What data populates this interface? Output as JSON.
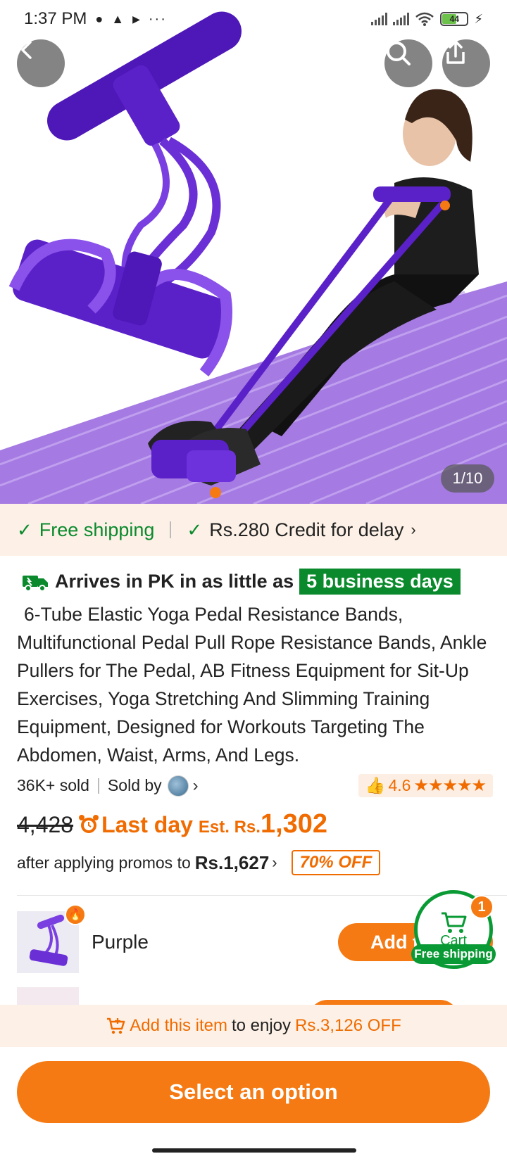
{
  "status_bar": {
    "time": "1:37 PM",
    "battery": "44",
    "left_icons": [
      "chat-icon",
      "snapchat-icon",
      "play-icon",
      "more-dots-icon"
    ],
    "right_icons": [
      "signal-icon",
      "signal-icon",
      "wifi-icon",
      "battery-icon",
      "charging-icon"
    ]
  },
  "hero": {
    "image_counter": "1/10",
    "icons": [
      "back-icon",
      "search-icon",
      "share-icon"
    ]
  },
  "shipping": {
    "free": "Free shipping",
    "credit": "Rs.280 Credit for delay"
  },
  "arrival": {
    "prefix": "Arrives in PK in as little as",
    "days": "5 business days"
  },
  "product": {
    "title": "6-Tube Elastic Yoga Pedal Resistance Bands, Multifunctional Pedal Pull Rope Resistance Bands, Ankle Pullers for The Pedal, AB Fitness Equipment for Sit-Up Exercises, Yoga Stretching And Slimming Training Equipment, Designed for Workouts Targeting The Abdomen, Waist, Arms, And Legs.",
    "sold": "36K+ sold",
    "sold_by": "Sold by",
    "rating": "4.6",
    "stars": "★★★★★"
  },
  "price": {
    "old": "4,428",
    "last_day": "Last day",
    "est_label": "Est. Rs.",
    "est": "1,302",
    "promo_text": "after applying promos to",
    "promo_price": "Rs.1,627",
    "off": "70% OFF"
  },
  "options": [
    {
      "label": "Purple",
      "button": "Add to cart"
    },
    {
      "label": "",
      "button": ""
    }
  ],
  "cart": {
    "label": "Cart",
    "count": "1",
    "shipping": "Free shipping"
  },
  "promo_banner": {
    "action": "Add this item",
    "middle": "to enjoy",
    "amount": "Rs.3,126 OFF"
  },
  "cta": "Select an option",
  "colors": {
    "accent": "#f57a13",
    "green": "#0a8a2d",
    "strip_bg": "#fdf1e7",
    "band_purple": "#5b21c9"
  }
}
